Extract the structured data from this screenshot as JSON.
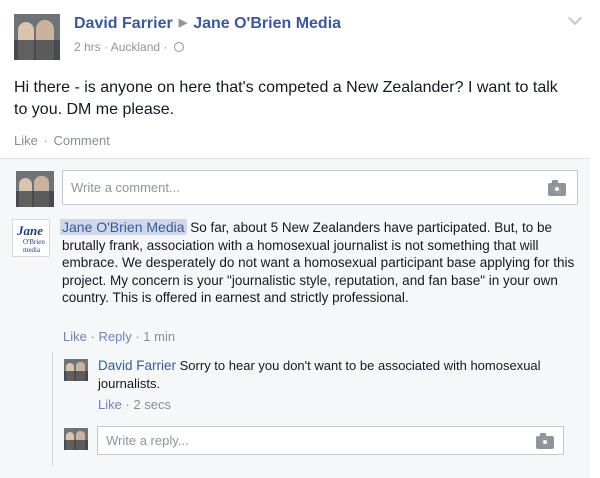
{
  "post": {
    "author": "David Farrier",
    "target": "Jane O'Brien Media",
    "time": "2 hrs",
    "location": "Auckland",
    "meta_separator": "·",
    "text": "Hi there - is anyone on here that's competed a New Zealander? I want to talk to you. DM me please.",
    "actions": {
      "like": "Like",
      "separator": "·",
      "comment": "Comment"
    }
  },
  "write_comment": {
    "placeholder": "Write a comment..."
  },
  "comment": {
    "author": "Jane O'Brien Media",
    "avatar_logo_line1": "Jane",
    "avatar_logo_line2": "O'Brien media",
    "text": "So far, about 5 New Zealanders have participated. But, to be brutally frank, association with a homosexual journalist is not something that will embrace. We desperately do not want a homosexual participant base applying for this project. My concern is your \"journalistic style, reputation, and fan base\" in your own country. This is offered in earnest and strictly professional.",
    "actions": {
      "like": "Like",
      "reply": "Reply",
      "time": "1 min",
      "separator": "·"
    }
  },
  "reply": {
    "author": "David Farrier",
    "text": "Sorry to hear you don't want to be associated with homosexual journalists.",
    "actions": {
      "like": "Like",
      "time": "2 secs",
      "separator": "·"
    }
  },
  "write_reply": {
    "placeholder": "Write a reply..."
  },
  "colors": {
    "link": "#3b5998",
    "muted": "#90949c",
    "panel": "#f6f7f9",
    "highlight": "#cfd8ea"
  },
  "icons": [
    "globe-icon",
    "chevron-down-icon",
    "camera-icon"
  ]
}
